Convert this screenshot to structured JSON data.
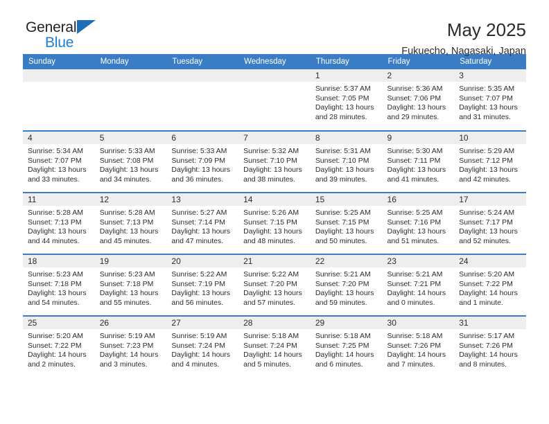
{
  "brand": {
    "name_part1": "General",
    "name_part2": "Blue",
    "logo_icon": "triangle-logo-icon"
  },
  "header": {
    "title": "May 2025",
    "subtitle": "Fukuecho, Nagasaki, Japan"
  },
  "calendar": {
    "weekday_headers": [
      "Sunday",
      "Monday",
      "Tuesday",
      "Wednesday",
      "Thursday",
      "Friday",
      "Saturday"
    ],
    "accent_color": "#3b7dc4",
    "daynum_bg": "#eeeeee",
    "weeks": [
      [
        {
          "day": "",
          "empty": true,
          "lines": []
        },
        {
          "day": "",
          "empty": true,
          "lines": []
        },
        {
          "day": "",
          "empty": true,
          "lines": []
        },
        {
          "day": "",
          "empty": true,
          "lines": []
        },
        {
          "day": "1",
          "empty": false,
          "lines": [
            "Sunrise: 5:37 AM",
            "Sunset: 7:05 PM",
            "Daylight: 13 hours",
            "and 28 minutes."
          ]
        },
        {
          "day": "2",
          "empty": false,
          "lines": [
            "Sunrise: 5:36 AM",
            "Sunset: 7:06 PM",
            "Daylight: 13 hours",
            "and 29 minutes."
          ]
        },
        {
          "day": "3",
          "empty": false,
          "lines": [
            "Sunrise: 5:35 AM",
            "Sunset: 7:07 PM",
            "Daylight: 13 hours",
            "and 31 minutes."
          ]
        }
      ],
      [
        {
          "day": "4",
          "empty": false,
          "lines": [
            "Sunrise: 5:34 AM",
            "Sunset: 7:07 PM",
            "Daylight: 13 hours",
            "and 33 minutes."
          ]
        },
        {
          "day": "5",
          "empty": false,
          "lines": [
            "Sunrise: 5:33 AM",
            "Sunset: 7:08 PM",
            "Daylight: 13 hours",
            "and 34 minutes."
          ]
        },
        {
          "day": "6",
          "empty": false,
          "lines": [
            "Sunrise: 5:33 AM",
            "Sunset: 7:09 PM",
            "Daylight: 13 hours",
            "and 36 minutes."
          ]
        },
        {
          "day": "7",
          "empty": false,
          "lines": [
            "Sunrise: 5:32 AM",
            "Sunset: 7:10 PM",
            "Daylight: 13 hours",
            "and 38 minutes."
          ]
        },
        {
          "day": "8",
          "empty": false,
          "lines": [
            "Sunrise: 5:31 AM",
            "Sunset: 7:10 PM",
            "Daylight: 13 hours",
            "and 39 minutes."
          ]
        },
        {
          "day": "9",
          "empty": false,
          "lines": [
            "Sunrise: 5:30 AM",
            "Sunset: 7:11 PM",
            "Daylight: 13 hours",
            "and 41 minutes."
          ]
        },
        {
          "day": "10",
          "empty": false,
          "lines": [
            "Sunrise: 5:29 AM",
            "Sunset: 7:12 PM",
            "Daylight: 13 hours",
            "and 42 minutes."
          ]
        }
      ],
      [
        {
          "day": "11",
          "empty": false,
          "lines": [
            "Sunrise: 5:28 AM",
            "Sunset: 7:13 PM",
            "Daylight: 13 hours",
            "and 44 minutes."
          ]
        },
        {
          "day": "12",
          "empty": false,
          "lines": [
            "Sunrise: 5:28 AM",
            "Sunset: 7:13 PM",
            "Daylight: 13 hours",
            "and 45 minutes."
          ]
        },
        {
          "day": "13",
          "empty": false,
          "lines": [
            "Sunrise: 5:27 AM",
            "Sunset: 7:14 PM",
            "Daylight: 13 hours",
            "and 47 minutes."
          ]
        },
        {
          "day": "14",
          "empty": false,
          "lines": [
            "Sunrise: 5:26 AM",
            "Sunset: 7:15 PM",
            "Daylight: 13 hours",
            "and 48 minutes."
          ]
        },
        {
          "day": "15",
          "empty": false,
          "lines": [
            "Sunrise: 5:25 AM",
            "Sunset: 7:15 PM",
            "Daylight: 13 hours",
            "and 50 minutes."
          ]
        },
        {
          "day": "16",
          "empty": false,
          "lines": [
            "Sunrise: 5:25 AM",
            "Sunset: 7:16 PM",
            "Daylight: 13 hours",
            "and 51 minutes."
          ]
        },
        {
          "day": "17",
          "empty": false,
          "lines": [
            "Sunrise: 5:24 AM",
            "Sunset: 7:17 PM",
            "Daylight: 13 hours",
            "and 52 minutes."
          ]
        }
      ],
      [
        {
          "day": "18",
          "empty": false,
          "lines": [
            "Sunrise: 5:23 AM",
            "Sunset: 7:18 PM",
            "Daylight: 13 hours",
            "and 54 minutes."
          ]
        },
        {
          "day": "19",
          "empty": false,
          "lines": [
            "Sunrise: 5:23 AM",
            "Sunset: 7:18 PM",
            "Daylight: 13 hours",
            "and 55 minutes."
          ]
        },
        {
          "day": "20",
          "empty": false,
          "lines": [
            "Sunrise: 5:22 AM",
            "Sunset: 7:19 PM",
            "Daylight: 13 hours",
            "and 56 minutes."
          ]
        },
        {
          "day": "21",
          "empty": false,
          "lines": [
            "Sunrise: 5:22 AM",
            "Sunset: 7:20 PM",
            "Daylight: 13 hours",
            "and 57 minutes."
          ]
        },
        {
          "day": "22",
          "empty": false,
          "lines": [
            "Sunrise: 5:21 AM",
            "Sunset: 7:20 PM",
            "Daylight: 13 hours",
            "and 59 minutes."
          ]
        },
        {
          "day": "23",
          "empty": false,
          "lines": [
            "Sunrise: 5:21 AM",
            "Sunset: 7:21 PM",
            "Daylight: 14 hours",
            "and 0 minutes."
          ]
        },
        {
          "day": "24",
          "empty": false,
          "lines": [
            "Sunrise: 5:20 AM",
            "Sunset: 7:22 PM",
            "Daylight: 14 hours",
            "and 1 minute."
          ]
        }
      ],
      [
        {
          "day": "25",
          "empty": false,
          "lines": [
            "Sunrise: 5:20 AM",
            "Sunset: 7:22 PM",
            "Daylight: 14 hours",
            "and 2 minutes."
          ]
        },
        {
          "day": "26",
          "empty": false,
          "lines": [
            "Sunrise: 5:19 AM",
            "Sunset: 7:23 PM",
            "Daylight: 14 hours",
            "and 3 minutes."
          ]
        },
        {
          "day": "27",
          "empty": false,
          "lines": [
            "Sunrise: 5:19 AM",
            "Sunset: 7:24 PM",
            "Daylight: 14 hours",
            "and 4 minutes."
          ]
        },
        {
          "day": "28",
          "empty": false,
          "lines": [
            "Sunrise: 5:18 AM",
            "Sunset: 7:24 PM",
            "Daylight: 14 hours",
            "and 5 minutes."
          ]
        },
        {
          "day": "29",
          "empty": false,
          "lines": [
            "Sunrise: 5:18 AM",
            "Sunset: 7:25 PM",
            "Daylight: 14 hours",
            "and 6 minutes."
          ]
        },
        {
          "day": "30",
          "empty": false,
          "lines": [
            "Sunrise: 5:18 AM",
            "Sunset: 7:26 PM",
            "Daylight: 14 hours",
            "and 7 minutes."
          ]
        },
        {
          "day": "31",
          "empty": false,
          "lines": [
            "Sunrise: 5:17 AM",
            "Sunset: 7:26 PM",
            "Daylight: 14 hours",
            "and 8 minutes."
          ]
        }
      ]
    ]
  }
}
